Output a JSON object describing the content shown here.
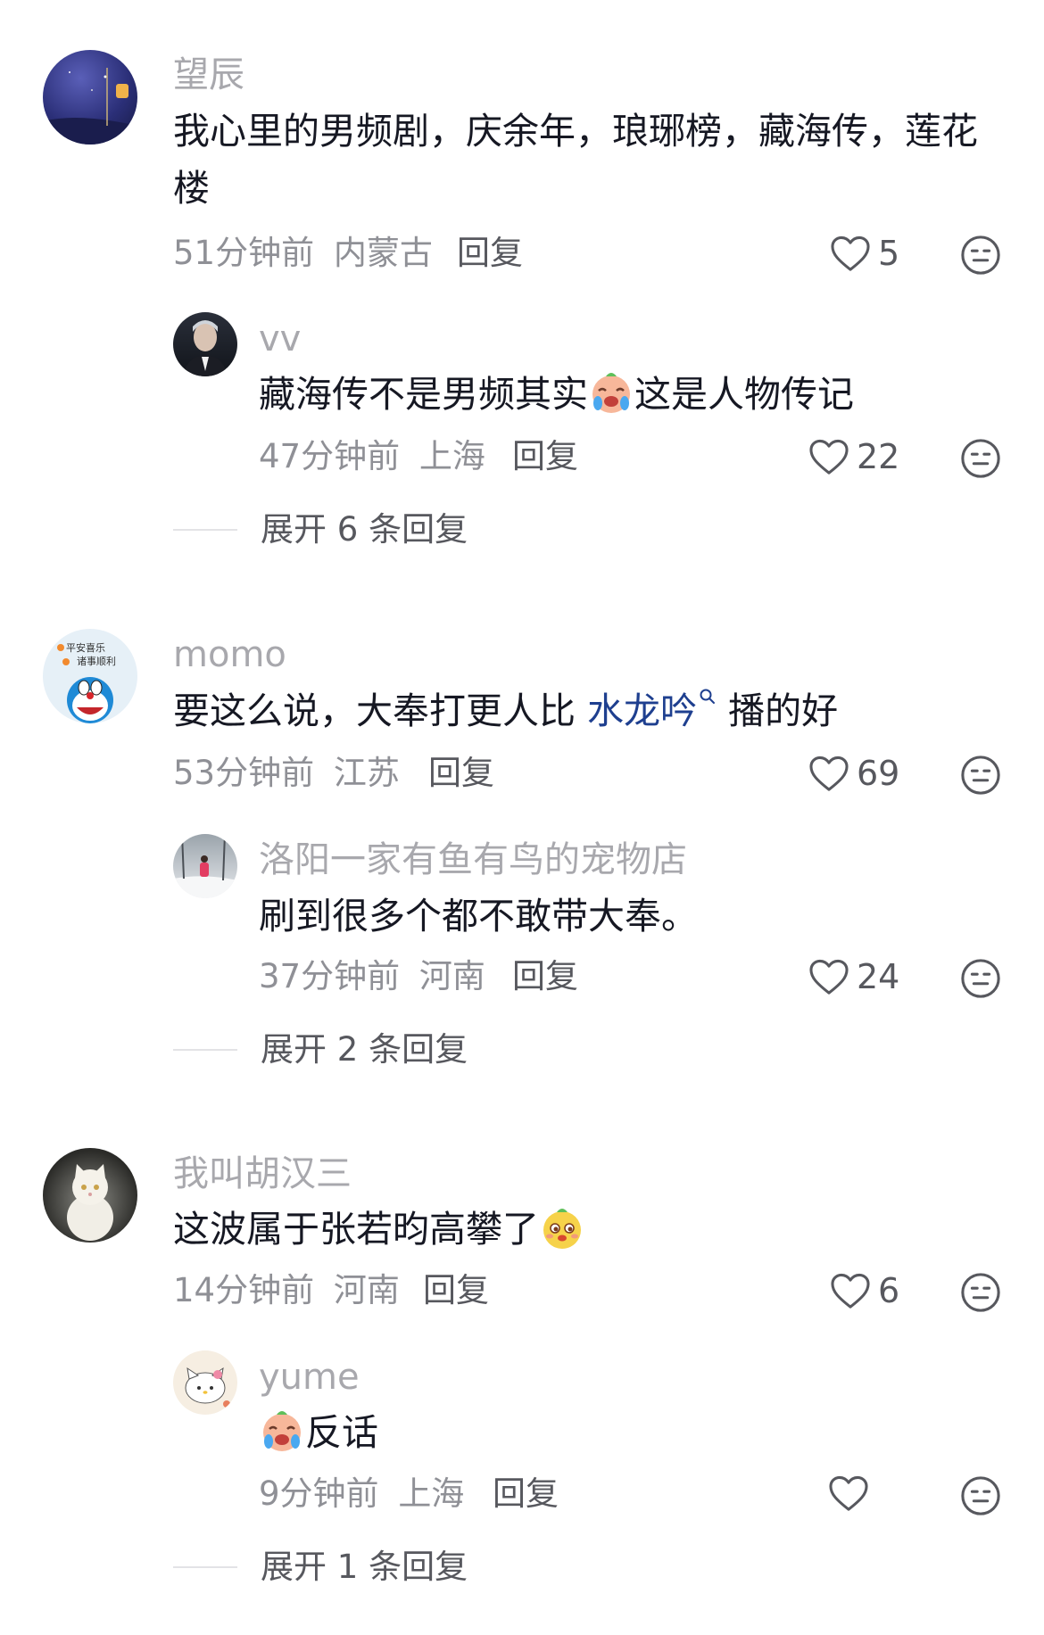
{
  "comments": [
    {
      "username": "望辰",
      "text": "我心里的男频剧，庆余年，琅琊榜，藏海传，莲花楼",
      "time": "51分钟前",
      "location": "内蒙古",
      "reply_label": "回复",
      "likes": "5",
      "replies": [
        {
          "username": "vv",
          "text_before": "藏海传不是男频其实",
          "text_after": "这是人物传记",
          "emoji": "crying-face",
          "time": "47分钟前",
          "location": "上海",
          "reply_label": "回复",
          "likes": "22"
        }
      ],
      "expand_label": "展开 6 条回复"
    },
    {
      "username": "momo",
      "avatar_text": [
        "平安喜乐",
        "诸事顺利"
      ],
      "text_before": "要这么说，大奉打更人比 ",
      "link_text": "水龙吟",
      "text_after": " 播的好",
      "time": "53分钟前",
      "location": "江苏",
      "reply_label": "回复",
      "likes": "69",
      "replies": [
        {
          "username": "洛阳一家有鱼有鸟的宠物店",
          "text": "刷到很多个都不敢带大奉。",
          "time": "37分钟前",
          "location": "河南",
          "reply_label": "回复",
          "likes": "24"
        }
      ],
      "expand_label": "展开 2 条回复"
    },
    {
      "username": "我叫胡汉三",
      "text": "这波属于张若昀高攀了",
      "emoji": "smug-face",
      "time": "14分钟前",
      "location": "河南",
      "reply_label": "回复",
      "likes": "6",
      "replies": [
        {
          "username": "yume",
          "emoji": "crying-face",
          "text": "反话",
          "time": "9分钟前",
          "location": "上海",
          "reply_label": "回复",
          "likes": ""
        }
      ],
      "expand_label": "展开 1 条回复"
    }
  ],
  "colors": {
    "username": "#a8a8ad",
    "text": "#161823",
    "meta": "#8f9096",
    "link": "#1e3f8f"
  },
  "icons": [
    "heart-outline-icon",
    "dislike-face-icon",
    "search-superscript-icon"
  ]
}
